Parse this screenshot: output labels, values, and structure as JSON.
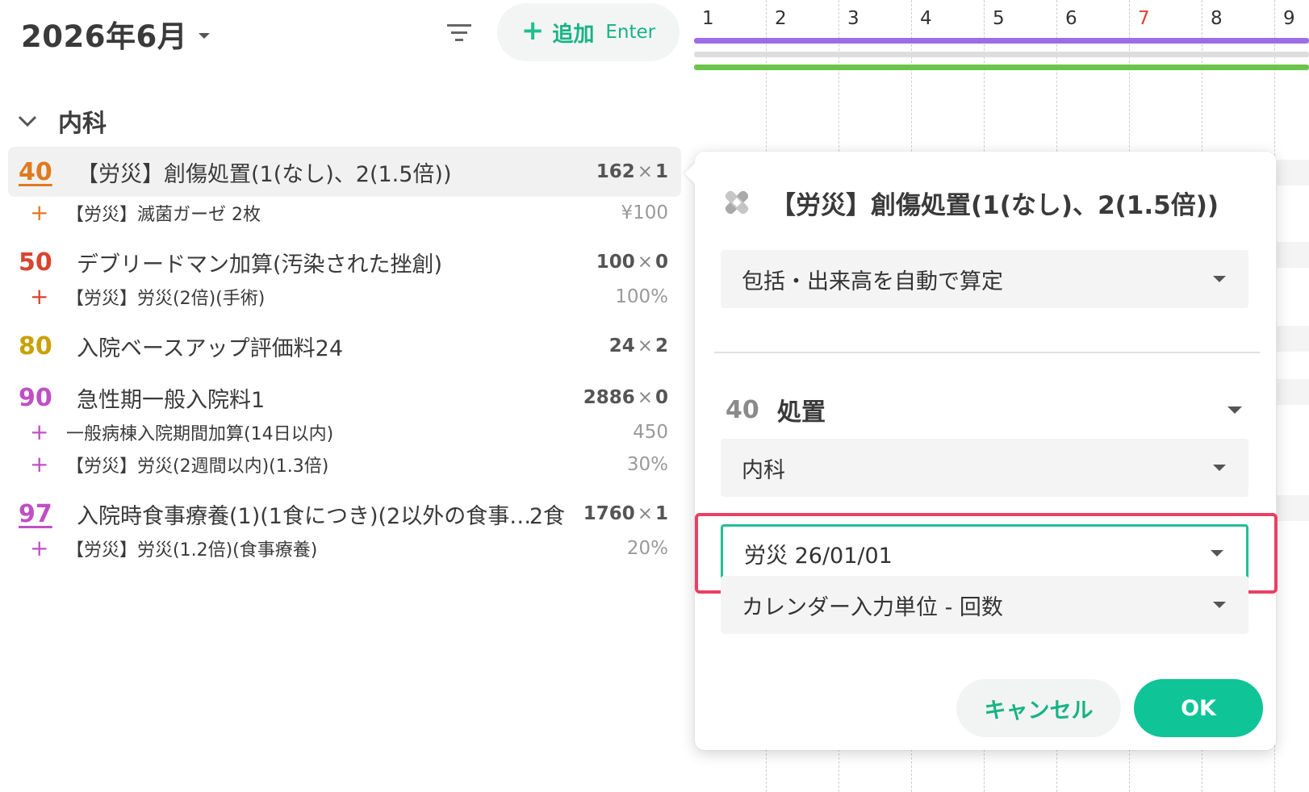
{
  "header": {
    "month": "2026年6月",
    "add_label": "追加",
    "add_shortcut": "Enter"
  },
  "section": {
    "title": "内科"
  },
  "items": [
    {
      "code": "40",
      "code_color": "#e07a1f",
      "name": "【労災】創傷処置(1(なし)、2(1.5倍))",
      "qty": "162",
      "times": "1",
      "selected": true,
      "subs": [
        {
          "name": "【労災】滅菌ガーゼ 2枚",
          "value": "¥100"
        }
      ]
    },
    {
      "code": "50",
      "code_color": "#d9442e",
      "name": "デブリードマン加算(汚染された挫創)",
      "qty": "100",
      "times": "0",
      "subs": [
        {
          "name": "【労災】労災(2倍)(手術)",
          "value": "100%"
        }
      ]
    },
    {
      "code": "80",
      "code_color": "#c9a000",
      "name": "入院ベースアップ評価料24",
      "qty": "24",
      "times": "2",
      "subs": []
    },
    {
      "code": "90",
      "code_color": "#c04fc6",
      "name": "急性期一般入院料1",
      "qty": "2886",
      "times": "0",
      "subs": [
        {
          "name": "一般病棟入院期間加算(14日以内)",
          "value": "450"
        },
        {
          "name": "【労災】労災(2週間以内)(1.3倍)",
          "value": "30%"
        }
      ]
    },
    {
      "code": "97",
      "code_color": "#c04fc6",
      "name": "入院時食事療養(1)(1食につき)(2以外の食事…",
      "unit": "2食",
      "qty": "1760",
      "times": "1",
      "subs": [
        {
          "name": "【労災】労災(1.2倍)(食事療養)",
          "value": "20%"
        }
      ]
    }
  ],
  "calendar": {
    "days": [
      "1",
      "2",
      "3",
      "4",
      "5",
      "6",
      "7",
      "8",
      "9"
    ],
    "holiday_day": "7",
    "bar_colors": [
      "#9b6ee6",
      "#dddddd",
      "#6cc44a"
    ]
  },
  "popover": {
    "title": "【労災】創傷処置(1(なし)、2(1.5倍))",
    "calc_mode": "包括・出来高を自動で算定",
    "category_code": "40",
    "category_name": "処置",
    "department": "内科",
    "insurance": "労災 26/01/01",
    "unit_mode": "カレンダー入力単位 - 回数",
    "cancel_label": "キャンセル",
    "ok_label": "OK",
    "accent_color": "#0fc496",
    "highlight_color": "#e94063"
  }
}
